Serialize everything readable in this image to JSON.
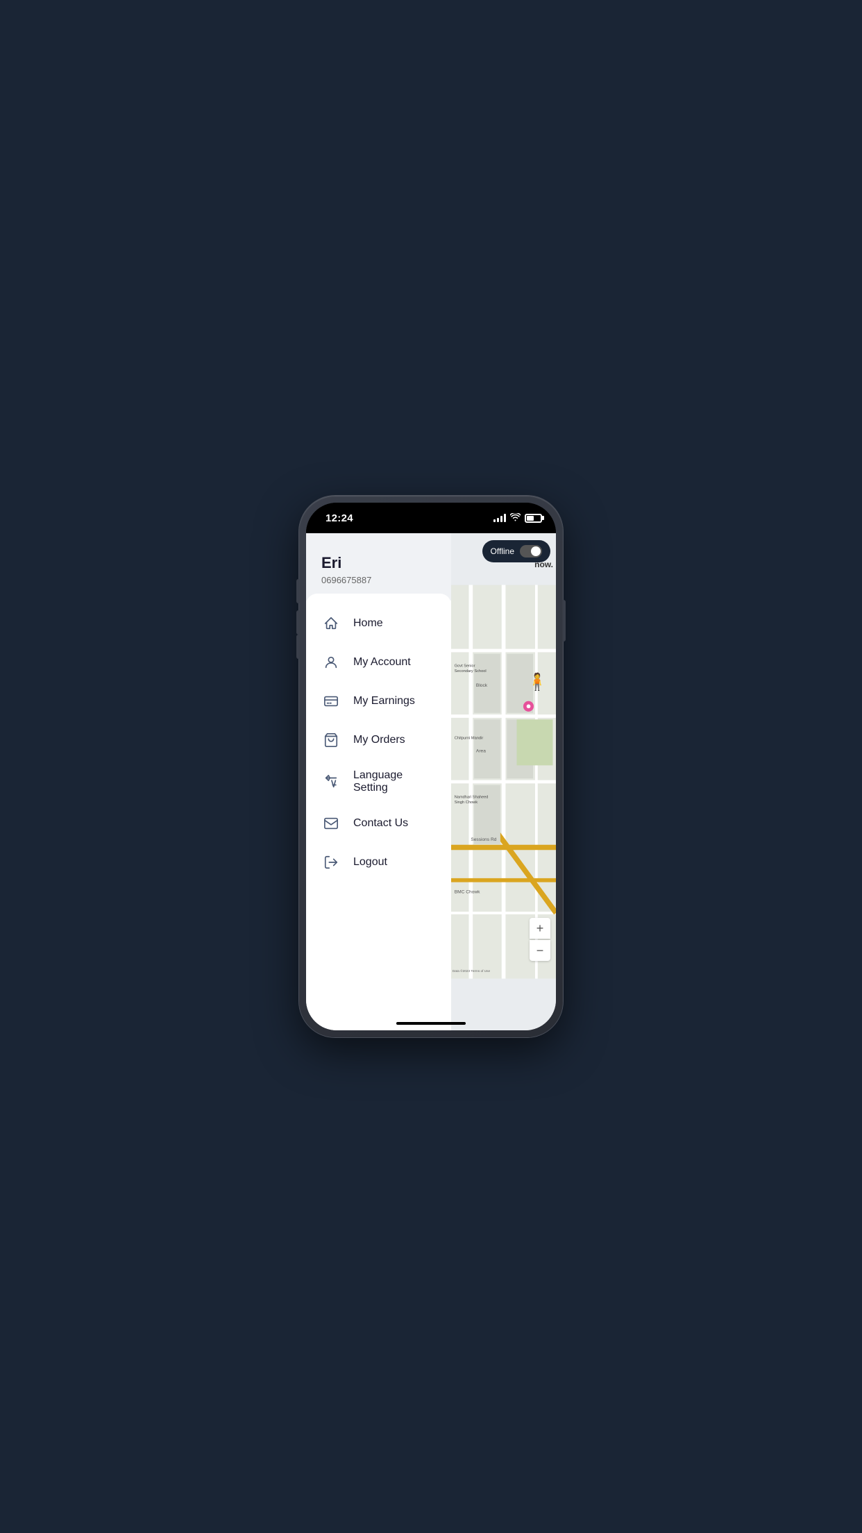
{
  "statusBar": {
    "time": "12:24",
    "batteryLevel": 50
  },
  "offline": {
    "label": "Offline"
  },
  "user": {
    "name": "Eri",
    "phone": "0696675887"
  },
  "menu": {
    "items": [
      {
        "id": "home",
        "label": "Home",
        "icon": "home"
      },
      {
        "id": "my-account",
        "label": "My Account",
        "icon": "account"
      },
      {
        "id": "my-earnings",
        "label": "My Earnings",
        "icon": "earnings"
      },
      {
        "id": "my-orders",
        "label": "My Orders",
        "icon": "orders"
      },
      {
        "id": "language-setting",
        "label": "Language Setting",
        "icon": "language"
      },
      {
        "id": "contact-us",
        "label": "Contact Us",
        "icon": "contact"
      },
      {
        "id": "logout",
        "label": "Logout",
        "icon": "logout"
      }
    ]
  },
  "map": {
    "nowLabel": "now.",
    "termsLabel": "Terms of Use",
    "dataLabel": "Data ©2023"
  }
}
